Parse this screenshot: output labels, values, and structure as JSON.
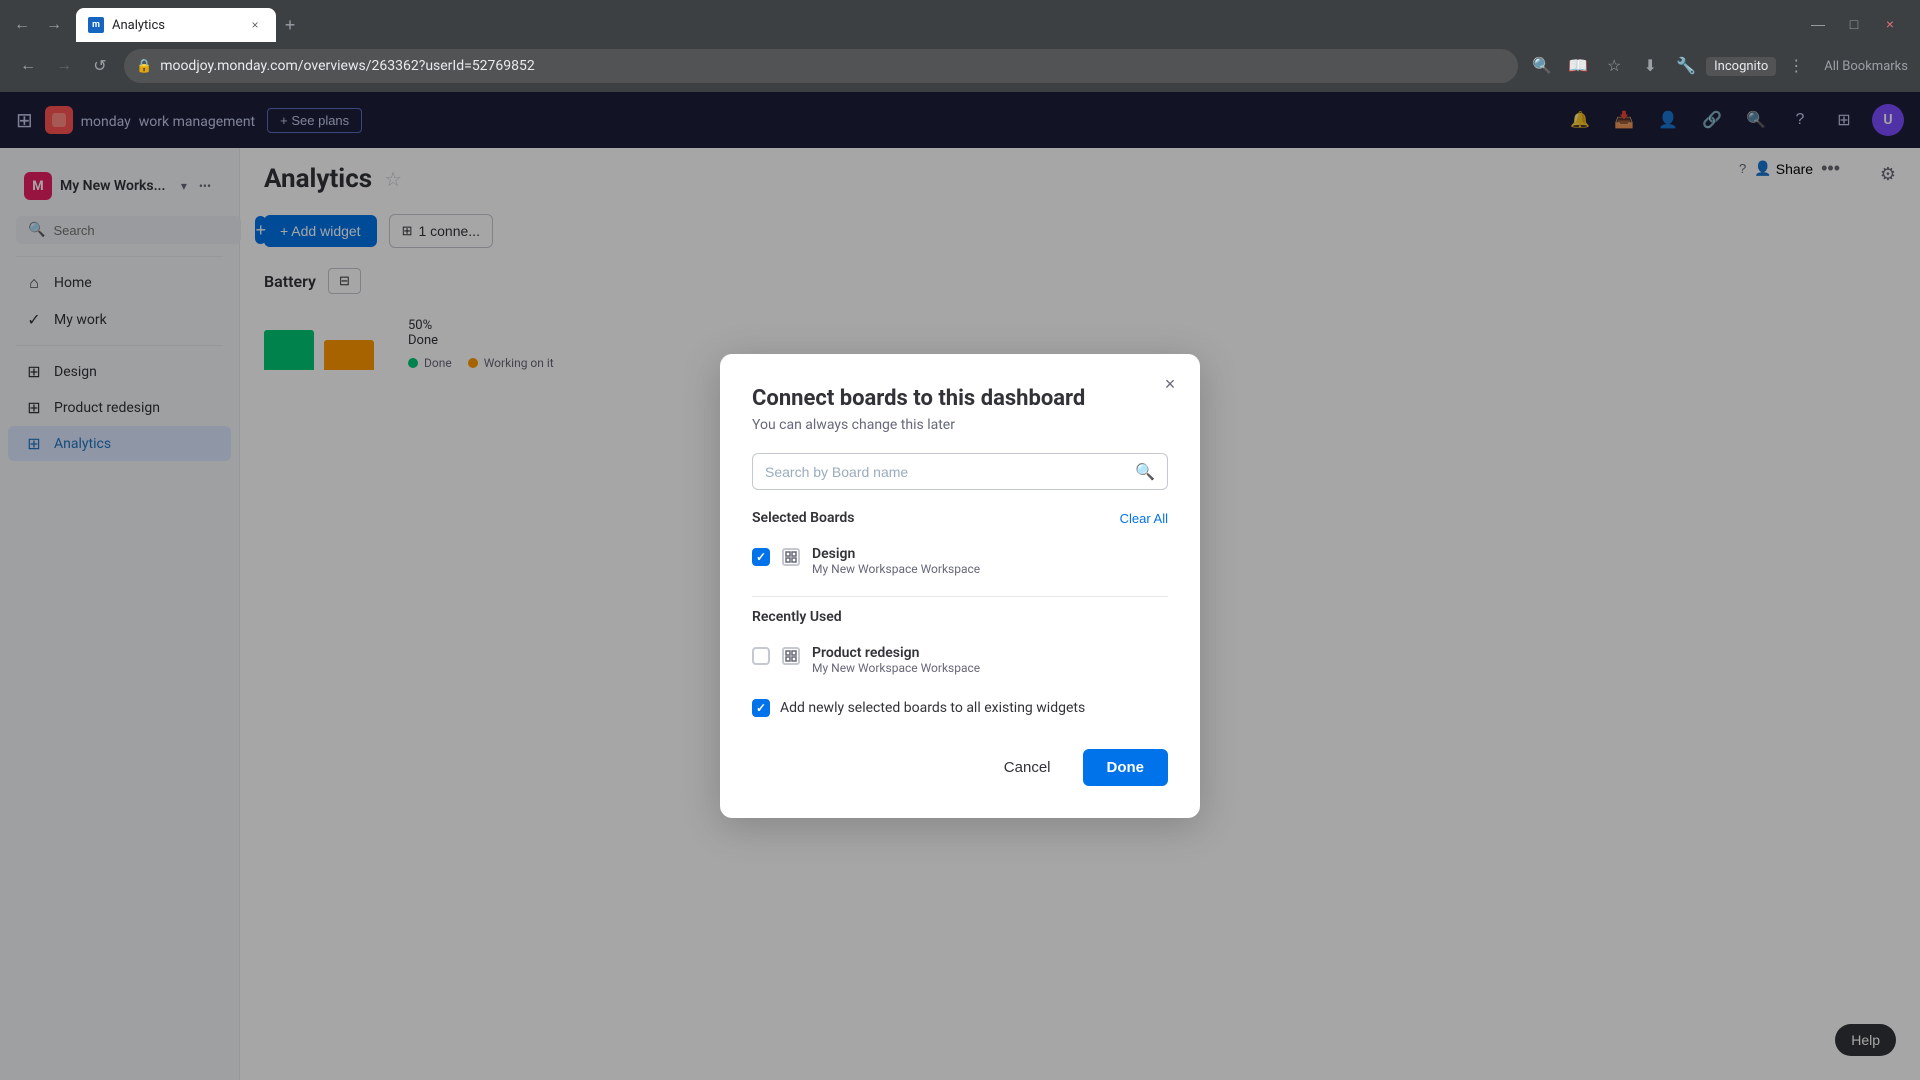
{
  "browser": {
    "tab_title": "Analytics",
    "tab_favicon": "m",
    "url": "moodjoy.monday.com/overviews/263362?userId=52769852",
    "incognito_label": "Incognito",
    "new_tab_icon": "+",
    "back_icon": "←",
    "forward_icon": "→",
    "refresh_icon": "↺",
    "home_icon": "⌂"
  },
  "topnav": {
    "logo_text": "monday",
    "logo_sub": "work management",
    "see_plans_label": "+ See plans",
    "brand_initials": "M"
  },
  "sidebar": {
    "workspace_name": "My New Works...",
    "workspace_icon": "M",
    "search_placeholder": "Search",
    "items": [
      {
        "label": "Home",
        "icon": "⌂",
        "active": false
      },
      {
        "label": "My work",
        "icon": "✓",
        "active": false
      },
      {
        "label": "Design",
        "icon": "⊞",
        "active": false
      },
      {
        "label": "Product redesign",
        "icon": "⊞",
        "active": false
      },
      {
        "label": "Analytics",
        "icon": "⊞",
        "active": true
      }
    ]
  },
  "page": {
    "title": "Analytics",
    "star_icon": "☆",
    "add_widget_label": "+ Add widget",
    "connected_label": "1 conne...",
    "battery_title": "Battery",
    "filter_icon": "⊟",
    "settings_icon": "⚙",
    "share_label": "Share",
    "more_icon": "...",
    "help_icon": "?",
    "chart": {
      "percent": "50%",
      "done_label": "Done",
      "working_label": "Working on it"
    },
    "legend": [
      {
        "label": "Done",
        "color": "#00c875"
      },
      {
        "label": "Working on it",
        "color": "#ff9800"
      }
    ]
  },
  "modal": {
    "title": "Connect boards to this dashboard",
    "subtitle": "You can always change this later",
    "close_icon": "×",
    "search_placeholder": "Search by Board name",
    "search_icon": "🔍",
    "selected_boards_label": "Selected Boards",
    "clear_all_label": "Clear All",
    "recently_used_label": "Recently Used",
    "add_new_boards_label": "Add newly selected boards to all existing widgets",
    "selected_boards": [
      {
        "name": "Design",
        "workspace": "My New Workspace Workspace",
        "checked": true
      }
    ],
    "recent_boards": [
      {
        "name": "Product redesign",
        "workspace": "My New Workspace Workspace",
        "checked": false
      }
    ],
    "cancel_label": "Cancel",
    "done_label": "Done"
  },
  "help_label": "Help"
}
